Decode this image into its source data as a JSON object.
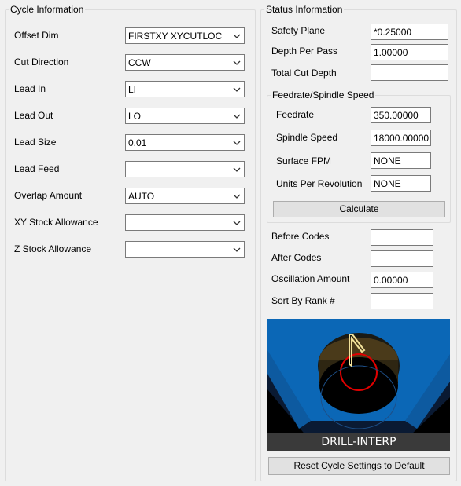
{
  "cycle_info": {
    "title": "Cycle Information",
    "fields": [
      {
        "label": "Offset Dim",
        "value": "FIRSTXY XYCUTLOC"
      },
      {
        "label": "Cut Direction",
        "value": "CCW"
      },
      {
        "label": "Lead In",
        "value": "LI"
      },
      {
        "label": "Lead Out",
        "value": "LO"
      },
      {
        "label": "Lead Size",
        "value": "0.01"
      },
      {
        "label": "Lead Feed",
        "value": ""
      },
      {
        "label": "Overlap Amount",
        "value": "AUTO"
      },
      {
        "label": "XY Stock Allowance",
        "value": ""
      },
      {
        "label": "Z Stock Allowance",
        "value": ""
      }
    ]
  },
  "status_info": {
    "title": "Status Information",
    "safety_plane": {
      "label": "Safety Plane",
      "value": "*0.25000"
    },
    "depth_per_pass": {
      "label": "Depth Per Pass",
      "value": "1.00000"
    },
    "total_cut_depth": {
      "label": "Total Cut Depth",
      "value": ""
    },
    "feedrate_group": {
      "title": "Feedrate/Spindle Speed",
      "feedrate": {
        "label": "Feedrate",
        "value": "350.00000"
      },
      "spindle_speed": {
        "label": "Spindle Speed",
        "value": "18000.00000"
      },
      "surface_fpm": {
        "label": "Surface FPM",
        "value": "NONE"
      },
      "units_per_rev": {
        "label": "Units Per Revolution",
        "value": "NONE"
      },
      "calculate_label": "Calculate"
    },
    "before_codes": {
      "label": "Before Codes",
      "value": ""
    },
    "after_codes": {
      "label": "After Codes",
      "value": ""
    },
    "oscillation_amount": {
      "label": "Oscillation Amount",
      "value": "0.00000"
    },
    "sort_by_rank": {
      "label": "Sort By Rank #",
      "value": ""
    },
    "preview_caption": "DRILL-INTERP",
    "reset_label": "Reset Cycle Settings to Default"
  },
  "colors": {
    "background": "#f0f0f0",
    "preview_blue": "#0b67b6",
    "caption_bar": "#3a3a3a"
  }
}
